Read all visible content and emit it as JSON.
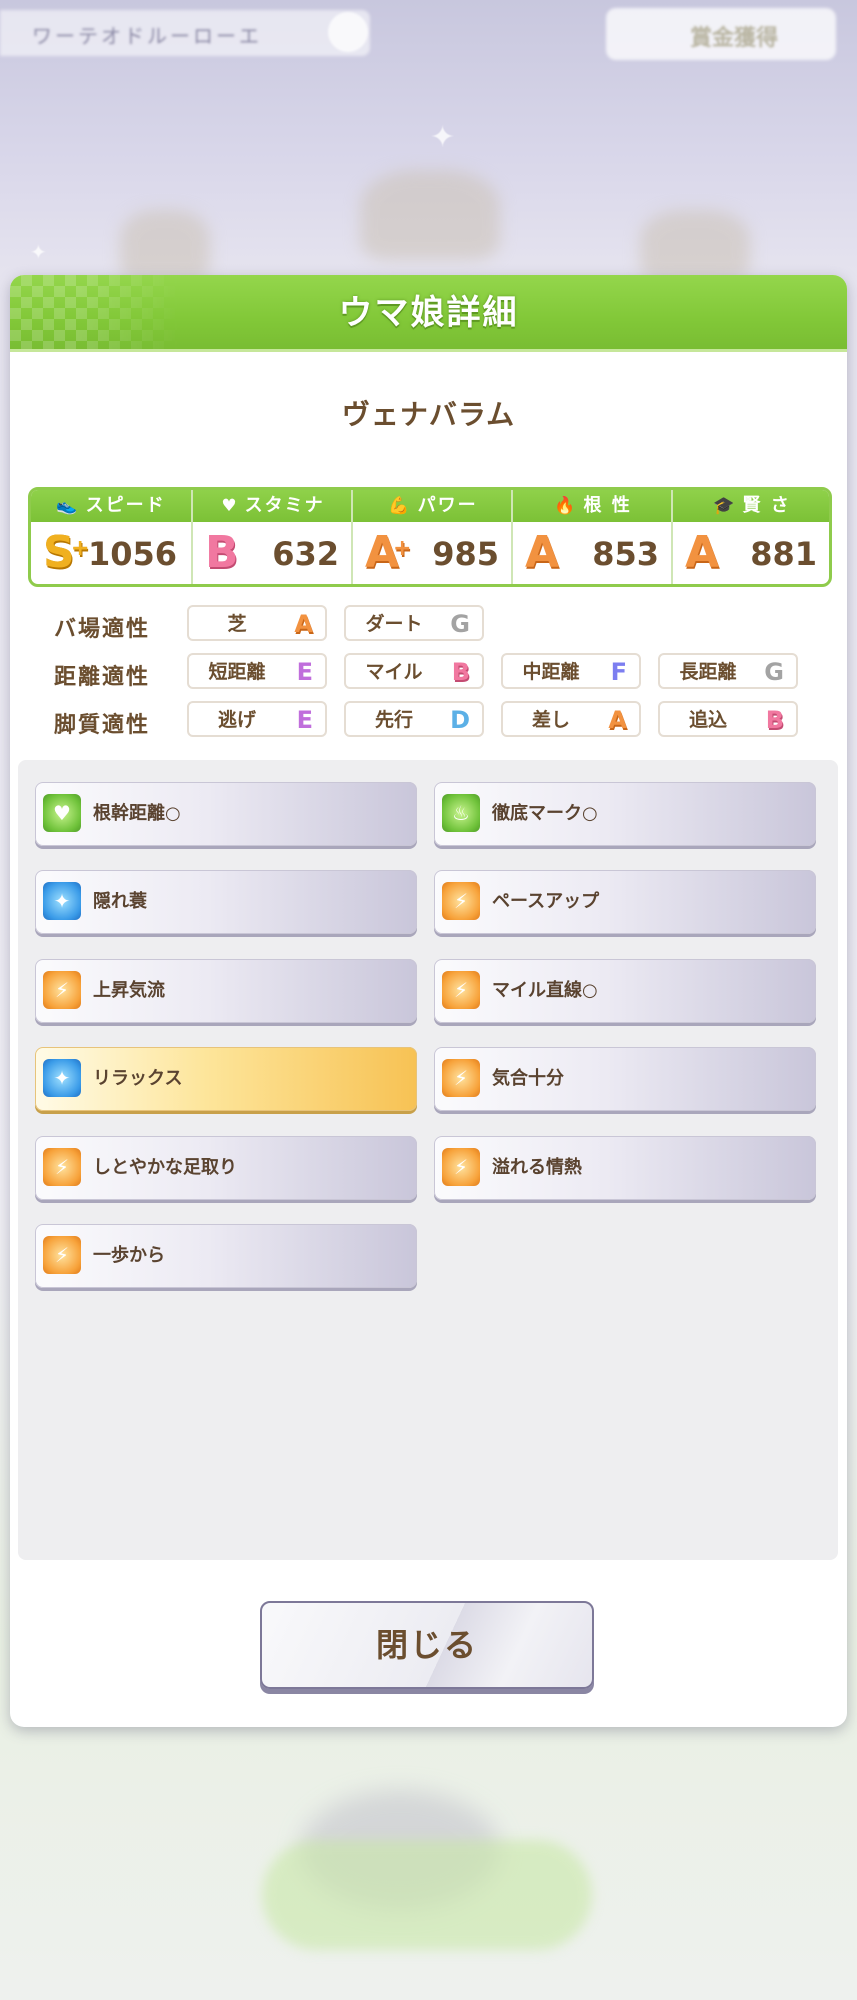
{
  "background": {
    "topbar_text": "ワーテオドルーローエ",
    "topright_text": "賞金獲得"
  },
  "dialog": {
    "title": "ウマ娘詳細",
    "horse_name": "ヴェナバラム"
  },
  "stats": [
    {
      "key": "speed",
      "label": "スピード",
      "icon": "shoe-icon",
      "grade": "S",
      "plus": "+",
      "value": "1056"
    },
    {
      "key": "stamina",
      "label": "スタミナ",
      "icon": "heart-icon",
      "grade": "B",
      "plus": "",
      "value": "632"
    },
    {
      "key": "power",
      "label": "パワー",
      "icon": "muscle-icon",
      "grade": "A",
      "plus": "+",
      "value": "985"
    },
    {
      "key": "guts",
      "label": "根 性",
      "icon": "flame-icon",
      "grade": "A",
      "plus": "",
      "value": "853"
    },
    {
      "key": "wisdom",
      "label": "賢 さ",
      "icon": "mortarboard-icon",
      "grade": "A",
      "plus": "",
      "value": "881"
    }
  ],
  "aptitude": {
    "track_label": "バ場適性",
    "distance_label": "距離適性",
    "style_label": "脚質適性",
    "track": [
      {
        "name": "芝",
        "grade": "A"
      },
      {
        "name": "ダート",
        "grade": "G"
      }
    ],
    "distance": [
      {
        "name": "短距離",
        "grade": "E"
      },
      {
        "name": "マイル",
        "grade": "B"
      },
      {
        "name": "中距離",
        "grade": "F"
      },
      {
        "name": "長距離",
        "grade": "G"
      }
    ],
    "style": [
      {
        "name": "逃げ",
        "grade": "E"
      },
      {
        "name": "先行",
        "grade": "D"
      },
      {
        "name": "差し",
        "grade": "A"
      },
      {
        "name": "追込",
        "grade": "B"
      }
    ]
  },
  "skills": [
    {
      "name": "根幹距離○",
      "icon": "heart-icon",
      "color": "green",
      "highlight": false
    },
    {
      "name": "徹底マーク○",
      "icon": "flame-icon",
      "color": "green",
      "highlight": false
    },
    {
      "name": "隠れ蓑",
      "icon": "sparkle-icon",
      "color": "blue",
      "highlight": false
    },
    {
      "name": "ペースアップ",
      "icon": "runner-icon",
      "color": "orange",
      "highlight": false
    },
    {
      "name": "上昇気流",
      "icon": "runner-icon",
      "color": "orange",
      "highlight": false
    },
    {
      "name": "マイル直線○",
      "icon": "runner-icon",
      "color": "orange",
      "highlight": false
    },
    {
      "name": "リラックス",
      "icon": "sparkle-icon",
      "color": "blue",
      "highlight": true
    },
    {
      "name": "気合十分",
      "icon": "runner-icon",
      "color": "orange",
      "highlight": false
    },
    {
      "name": "しとやかな足取り",
      "icon": "runner-icon",
      "color": "orange",
      "highlight": false
    },
    {
      "name": "溢れる情熱",
      "icon": "runner-icon",
      "color": "orange",
      "highlight": false
    },
    {
      "name": "一歩から",
      "icon": "runner-icon",
      "color": "orange",
      "highlight": false
    }
  ],
  "close_label": "閉じる"
}
